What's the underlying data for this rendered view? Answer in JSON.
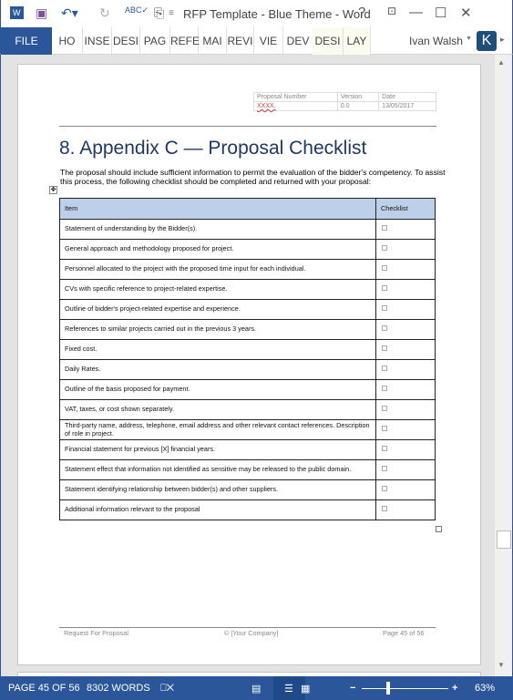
{
  "titlebar": {
    "title": "RFP Template - Blue Theme - Word",
    "help": "?",
    "minimize": "—",
    "maximize": "☐",
    "close": "✕"
  },
  "ribbon": {
    "file": "FILE",
    "tabs": [
      "HO",
      "INSE",
      "DESI",
      "PAG",
      "REFE",
      "MAI",
      "REVI",
      "VIE",
      "DEV",
      "DESI",
      "LAY"
    ],
    "user": "Ivan Walsh",
    "avatar": "K"
  },
  "doc_header": {
    "labels": [
      "Proposal Number",
      "Version",
      "Date"
    ],
    "values": [
      "XXXX.",
      "0.0",
      "13/05/2017"
    ]
  },
  "heading": "8.  Appendix C — Proposal Checklist",
  "intro": "The proposal should include sufficient information to permit the evaluation of the bidder's competency. To assist this process, the following checklist should be completed and returned with your proposal:",
  "table": {
    "headers": [
      "Item",
      "Checklist"
    ],
    "rows": [
      "Statement of understanding by the Bidder(s).",
      "General approach and methodology proposed for project.",
      "Personnel allocated to the project with the proposed time input for each individual.",
      "CVs with specific reference to project-related expertise.",
      "Outline of bidder's project-related expertise and experience.",
      "References to similar projects carried out in the previous 3 years.",
      "Fixed cost.",
      "Daily Rates.",
      "Outline of the basis proposed for payment.",
      "VAT, taxes, or cost shown separately.",
      "Third-party name, address, telephone, email address and other relevant contact references. Description of role in project.",
      "Financial statement for previous [X] financial years.",
      "Statement effect that information not identified as sensitive may be released to the public domain.",
      "Statement identifying relationship between bidder(s) and other suppliers.",
      "Additional information relevant to the proposal"
    ]
  },
  "footer": {
    "left": "Request For Proposal",
    "center": "© [Your Company]",
    "right": "Page 45 of 56"
  },
  "status": {
    "page": "PAGE 45 OF 56",
    "words": "8302 WORDS",
    "zoom": "63%",
    "zoom_minus": "−",
    "zoom_plus": "+",
    "zoom_percent": 63
  }
}
